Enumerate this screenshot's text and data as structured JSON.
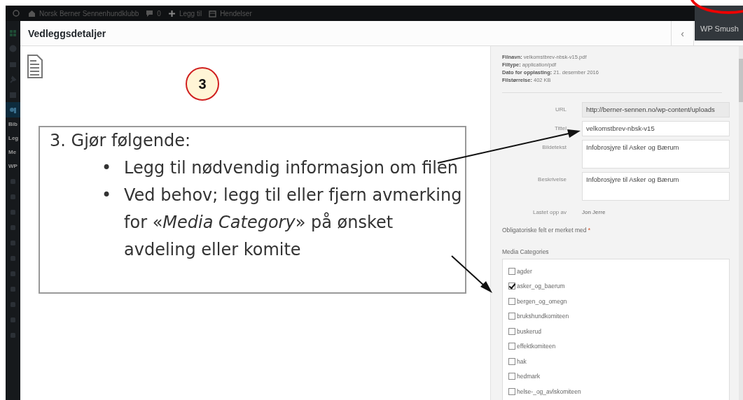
{
  "admin_bar": {
    "site": "Norsk Berner Sennenhundklubb",
    "comments": "0",
    "new": "Legg til",
    "events": "Hendelser"
  },
  "sidebar": {
    "submenu": [
      "Bib",
      "Leg",
      "Me",
      "WP"
    ]
  },
  "modal": {
    "title": "Vedleggsdetaljer",
    "previous": "‹",
    "dropdown": [
      "WP Smush"
    ]
  },
  "details": {
    "meta": [
      {
        "label": "Filnavn:",
        "value": "velkomstbrev-nbsk-v15.pdf"
      },
      {
        "label": "Filtype:",
        "value": "application/pdf"
      },
      {
        "label": "Dato for opplasting:",
        "value": "21. desember 2016"
      },
      {
        "label": "Filstørrelse:",
        "value": "402 KB"
      }
    ],
    "fields": [
      {
        "label": "URL",
        "value": "http://berner-sennen.no/wp-content/uploads",
        "kind": "readonly"
      },
      {
        "label": "Tittel",
        "value": "velkomstbrev-nbsk-v15",
        "kind": "input"
      },
      {
        "label": "Bildetekst",
        "value": "Infobrosjyre til Asker og Bærum",
        "kind": "textarea"
      },
      {
        "label": "Beskrivelse",
        "value": "Infobrosjyre til Asker og Bærum",
        "kind": "textarea"
      }
    ],
    "uploaded_by": {
      "label": "Lastet opp av",
      "value": "Jon Jerre"
    },
    "required_note": "Obligatoriske felt er merket med",
    "required_mark": "*",
    "media_categories": {
      "title": "Media Categories",
      "items": [
        {
          "label": "agder",
          "checked": false
        },
        {
          "label": "asker_og_baerum",
          "checked": true
        },
        {
          "label": "bergen_og_omegn",
          "checked": false
        },
        {
          "label": "brukshundkomiteen",
          "checked": false
        },
        {
          "label": "buskerud",
          "checked": false
        },
        {
          "label": "effektkomiteen",
          "checked": false
        },
        {
          "label": "hak",
          "checked": false
        },
        {
          "label": "hedmark",
          "checked": false
        },
        {
          "label": "helse-_og_avlskomiteen",
          "checked": false
        }
      ]
    }
  },
  "callout": {
    "step": "3",
    "intro": "3. Gjør følgende:",
    "bullet_marker": "•",
    "bullets": [
      "Legg til nødvendig informasjon om filen",
      "Ved behov; legg til eller fjern avmerking for «*Media Category*» på ønsket avdeling eller komite"
    ]
  }
}
